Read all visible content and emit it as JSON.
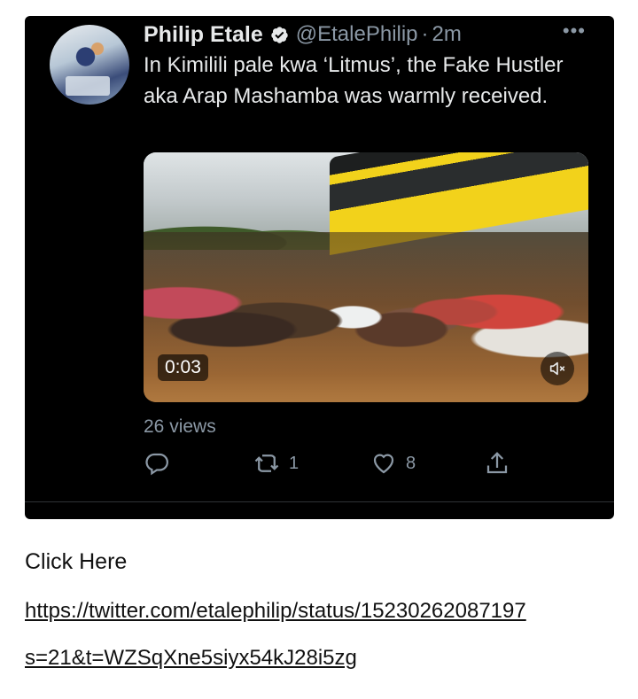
{
  "tweet": {
    "author_name": "Philip Etale",
    "handle": "@EtalePhilip",
    "separator": "·",
    "time": "2m",
    "more_label": "•••",
    "text": "In Kimilili pale kwa ‘Litmus’, the Fake Hustler aka Arap Mashamba was warmly received.",
    "video": {
      "duration": "0:03",
      "mute_icon": "muted-speaker-icon"
    },
    "views": "26 views",
    "actions": {
      "reply_icon": "reply-icon",
      "retweet_icon": "retweet-icon",
      "retweet_count": "1",
      "like_icon": "heart-icon",
      "like_count": "8",
      "share_icon": "share-icon"
    }
  },
  "page": {
    "click_here": "Click Here",
    "url_line1": "https://twitter.com/etalephilip/status/15230262087197",
    "url_line2": "s=21&t=WZSqXne5siyx54kJ28i5zg"
  },
  "colors": {
    "tweet_background": "#000000",
    "text_primary": "#e7e9ea",
    "text_secondary": "#8b98a5",
    "verified_badge": "#e7e9ea",
    "page_background": "#ffffff"
  }
}
